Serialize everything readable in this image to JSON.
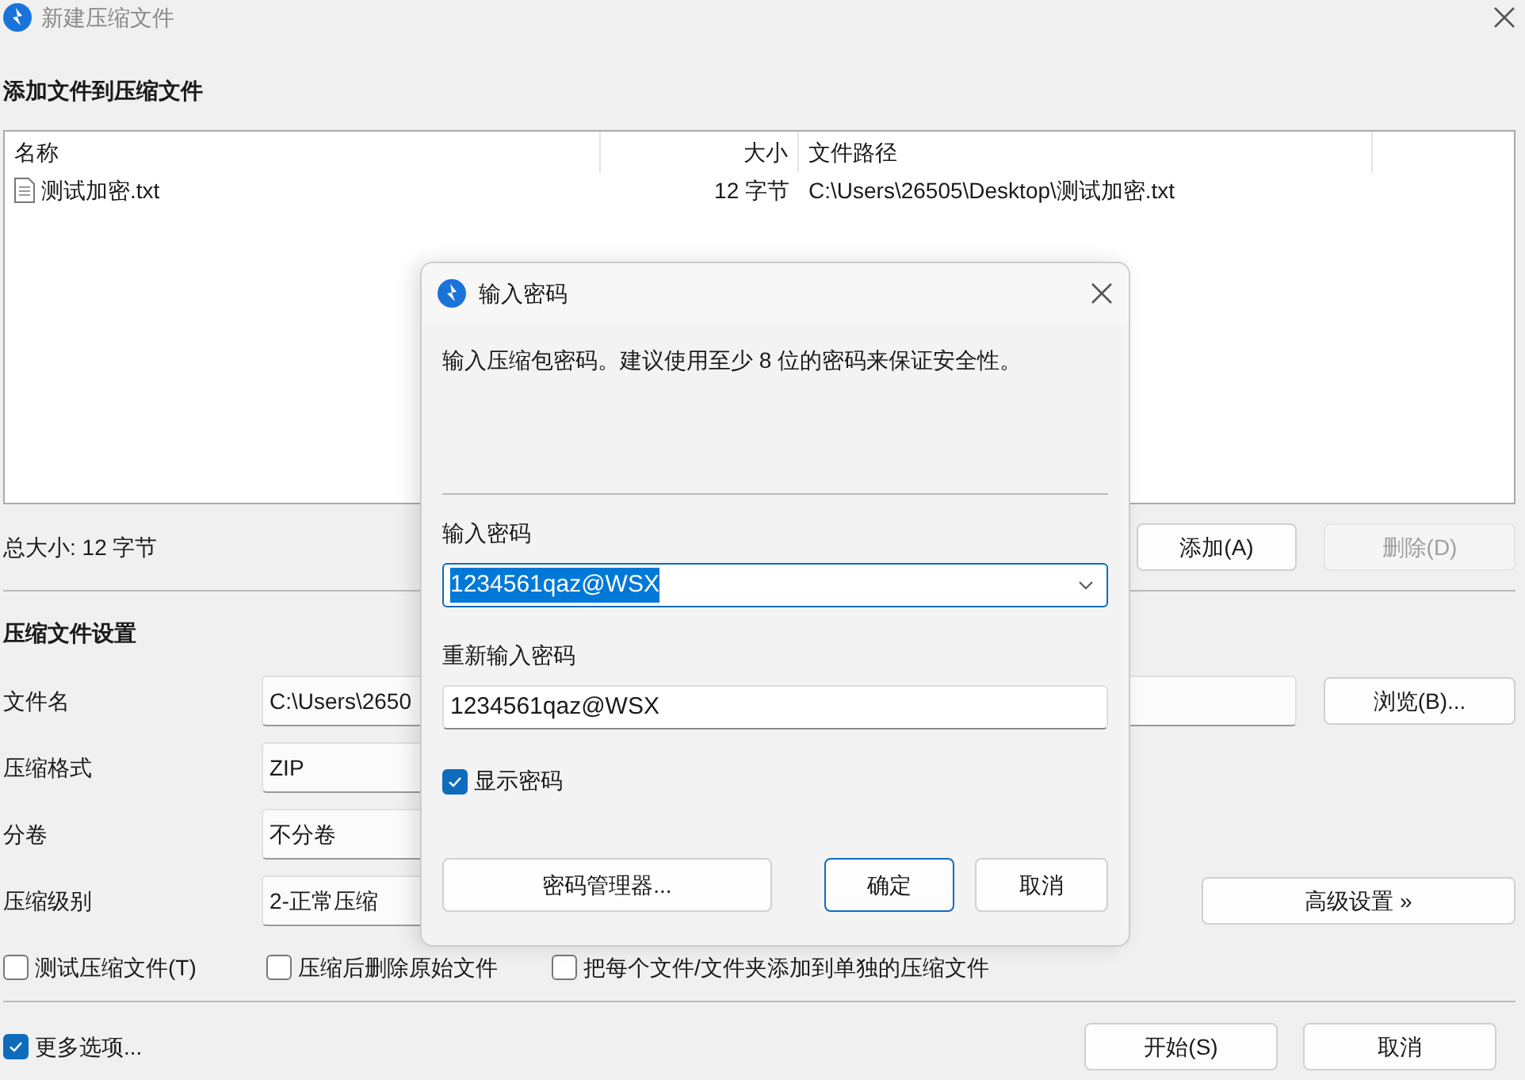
{
  "window": {
    "title": "新建压缩文件"
  },
  "files_section": {
    "heading": "添加文件到压缩文件",
    "columns": [
      "名称",
      "大小",
      "文件路径"
    ],
    "rows": [
      {
        "name": "测试加密.txt",
        "size": "12 字节",
        "path": "C:\\Users\\26505\\Desktop\\测试加密.txt"
      }
    ],
    "total": "总大小: 12 字节",
    "buttons": [
      {
        "label": "添加(A)",
        "disabled": false
      },
      {
        "label": "删除(D)",
        "disabled": true
      }
    ]
  },
  "settings": {
    "heading": "压缩文件设置",
    "fields": [
      {
        "label": "文件名",
        "value": "C:\\Users\\2650"
      },
      {
        "label": "压缩格式",
        "value": "ZIP"
      },
      {
        "label": "分卷",
        "value": "不分卷"
      },
      {
        "label": "压缩级别",
        "value": "2-正常压缩"
      }
    ],
    "browse_button": "浏览(B)...",
    "advanced_button": "高级设置 »",
    "options": [
      {
        "label": "测试压缩文件(T)",
        "checked": false
      },
      {
        "label": "压缩后删除原始文件",
        "checked": false
      },
      {
        "label": "把每个文件/文件夹添加到单独的压缩文件",
        "checked": false
      }
    ]
  },
  "more_options": {
    "label": "更多选项...",
    "checked": true
  },
  "buttons": [
    "开始(S)",
    "取消"
  ],
  "dialog": {
    "title": "输入密码",
    "message": "输入压缩包密码。建议使用至少 8 位的密码来保证安全性。",
    "password_label": "输入密码",
    "password": "1234561qaz@WSX",
    "repeat_label": "重新输入密码",
    "repeat": "1234561qaz@WSX",
    "show_password": {
      "label": "显示密码",
      "checked": true
    },
    "buttons": [
      {
        "label": "密码管理器...",
        "default": false
      },
      {
        "label": "确定",
        "default": true
      },
      {
        "label": "取消",
        "default": false
      }
    ]
  }
}
